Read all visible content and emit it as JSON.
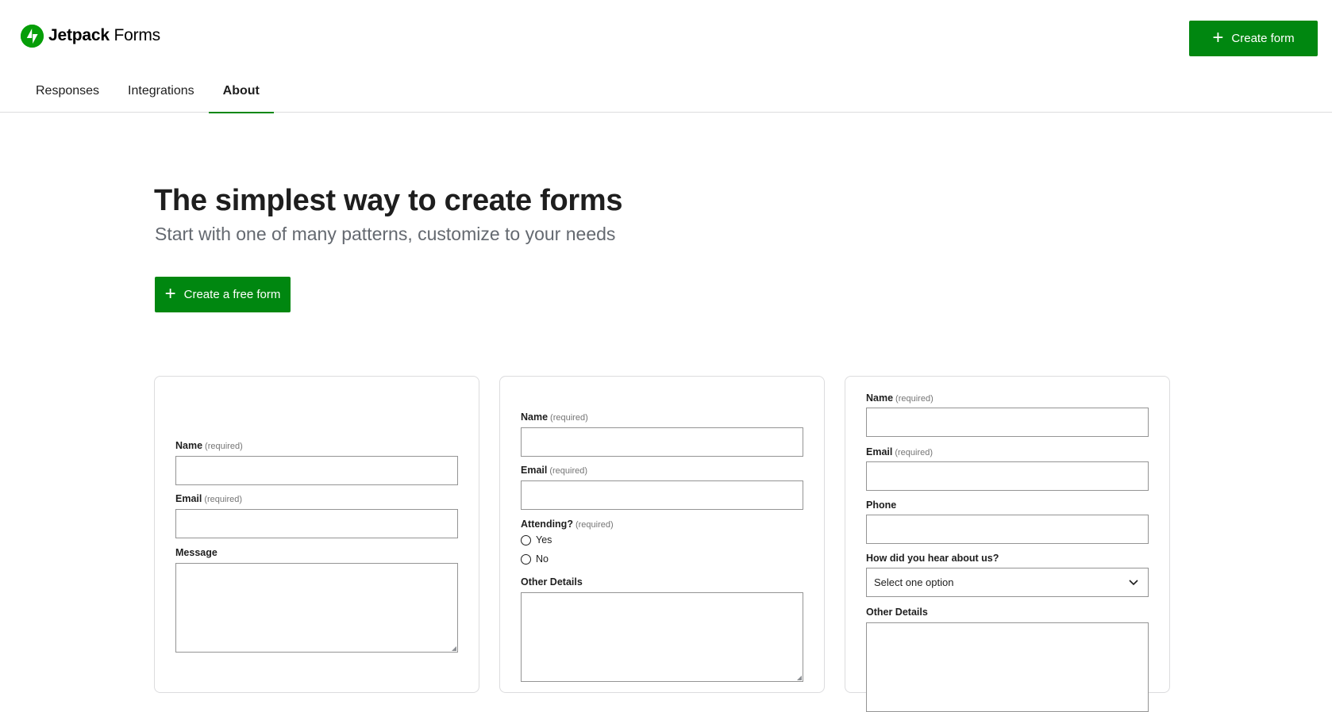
{
  "header": {
    "brand_bold": "Jetpack",
    "brand_light": "Forms",
    "create_button_label": "Create form",
    "brand_color": "#069e08",
    "accent_color": "#008710"
  },
  "tabs": [
    {
      "label": "Responses",
      "active": false
    },
    {
      "label": "Integrations",
      "active": false
    },
    {
      "label": "About",
      "active": true
    }
  ],
  "hero": {
    "title": "The simplest way to create forms",
    "subtitle": "Start with one of many patterns, customize to your needs",
    "cta_label": "Create a free form"
  },
  "patterns": {
    "contact": {
      "name_label": "Name",
      "name_req": "(required)",
      "email_label": "Email",
      "email_req": "(required)",
      "message_label": "Message"
    },
    "rsvp": {
      "name_label": "Name",
      "name_req": "(required)",
      "email_label": "Email",
      "email_req": "(required)",
      "attending_label": "Attending?",
      "attending_req": "(required)",
      "option_yes": "Yes",
      "option_no": "No",
      "details_label": "Other Details"
    },
    "registration": {
      "name_label": "Name",
      "name_req": "(required)",
      "email_label": "Email",
      "email_req": "(required)",
      "phone_label": "Phone",
      "hear_label": "How did you hear about us?",
      "hear_selected": "Select one option",
      "details_label": "Other Details"
    }
  }
}
